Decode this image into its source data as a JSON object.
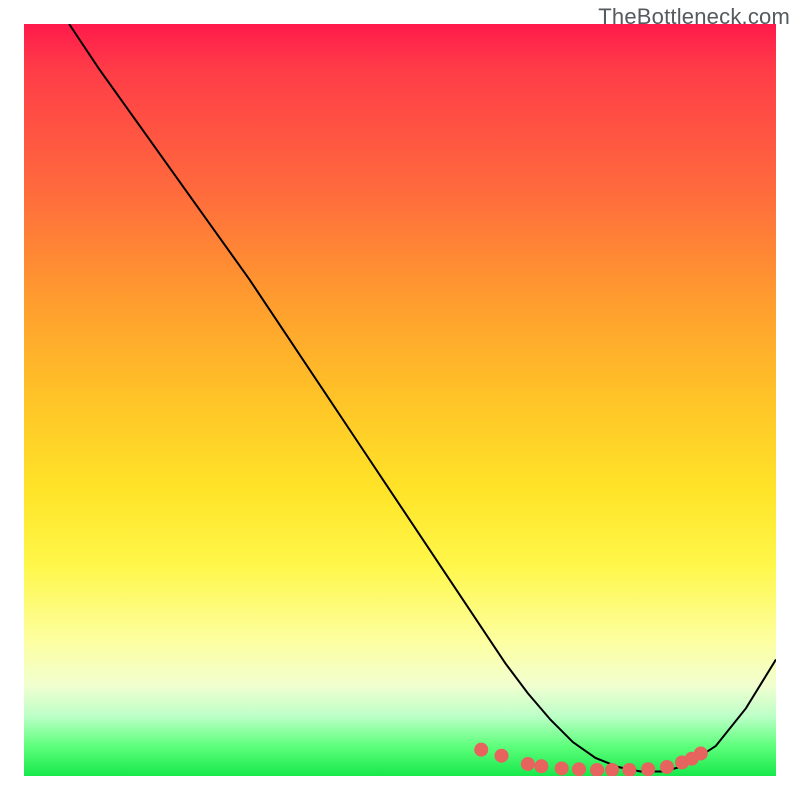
{
  "watermark": "TheBottleneck.com",
  "chart_data": {
    "type": "line",
    "title": "",
    "xlabel": "",
    "ylabel": "",
    "xlim": [
      0,
      100
    ],
    "ylim": [
      0,
      100
    ],
    "grid": false,
    "series": [
      {
        "name": "curve",
        "x": [
          6,
          10,
          15,
          20,
          25,
          30,
          35,
          40,
          45,
          50,
          55,
          60,
          64,
          67,
          70,
          73,
          76,
          79,
          82,
          85,
          88,
          92,
          96,
          100
        ],
        "y": [
          100,
          94,
          87,
          80,
          73,
          66,
          58.5,
          51,
          43.5,
          36,
          28.5,
          21,
          15,
          11,
          7.5,
          4.5,
          2.4,
          1.2,
          0.6,
          0.6,
          1.4,
          4,
          9,
          15.5
        ],
        "stroke": "#000000",
        "stroke_width": 2
      }
    ],
    "points": {
      "name": "dots",
      "color": "#e6635e",
      "radius": 7,
      "x": [
        60.8,
        63.5,
        67.0,
        68.8,
        71.5,
        73.8,
        76.2,
        78.2,
        80.5,
        83.0,
        85.5,
        87.5,
        88.8,
        90.0
      ],
      "y": [
        3.5,
        2.7,
        1.6,
        1.3,
        1.0,
        0.9,
        0.8,
        0.8,
        0.8,
        0.9,
        1.2,
        1.8,
        2.3,
        3.0
      ]
    }
  }
}
